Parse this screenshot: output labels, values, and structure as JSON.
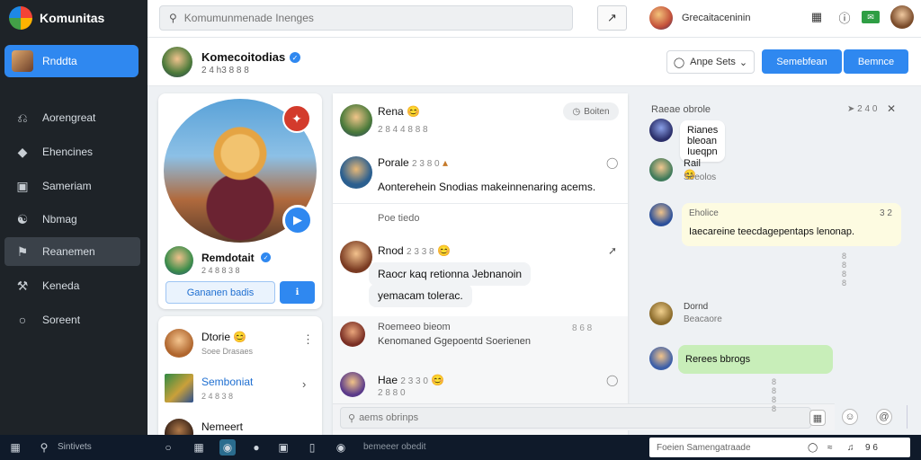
{
  "app": {
    "name": "Komunitas"
  },
  "sidebar": {
    "active": {
      "label": "Rnddta"
    },
    "items": [
      {
        "label": "Aorengreat",
        "icon": "headset-icon"
      },
      {
        "label": "Ehencines",
        "icon": "tag-icon"
      },
      {
        "label": "Sameriam",
        "icon": "film-icon"
      },
      {
        "label": "Nbmag",
        "icon": "globe-icon"
      },
      {
        "label": "Reanemen",
        "icon": "flag-icon"
      },
      {
        "label": "Keneda",
        "icon": "wrench-icon"
      },
      {
        "label": "Soreent",
        "icon": "circle-icon"
      }
    ]
  },
  "topbar": {
    "search_placeholder": "Komumunmenade Inenges",
    "user_label": "Grecaitaceninin"
  },
  "header": {
    "title": "Komecoitodias",
    "meta": "2 4 h3 8 8 8",
    "sort_label": "Anpe Sets",
    "primary_1": "Semebfean",
    "primary_2": "Bemnce"
  },
  "profile": {
    "name": "Remdotait",
    "meta": "2 4 8 8 3 8",
    "follow_label": "Gananen badis"
  },
  "friends": [
    {
      "name": "Dtorie",
      "emoji": "😊",
      "sub": "Soee Drasaes"
    },
    {
      "name": "Semboniat",
      "sub": "2 4 8 3 8"
    },
    {
      "name": "Nemeert"
    }
  ],
  "feed": {
    "chip": "Boiten",
    "posts": [
      {
        "name": "Rena",
        "emoji": "😊",
        "meta": "2 8 4 4 8 8 8"
      },
      {
        "name": "Porale",
        "meta": "2 3 8 0",
        "body": "Aonterehein Snodias makeinnenaring acems."
      },
      {
        "divider_label": "Poe tiedo"
      },
      {
        "name": "Rnod",
        "meta": "2 3 3 8",
        "body1": "Raocr kaq retionna Jebnanoin",
        "body2": "yemacam tolerac."
      },
      {
        "name": "Roemeeo bieom",
        "sub": "Kenomaned Ggepoentd Soerienen",
        "time": "8 6 8"
      },
      {
        "name": "Hae",
        "emoji": "😊",
        "meta": "2 3 3 0",
        "sub": "2 8 8 0"
      }
    ]
  },
  "compose": {
    "placeholder": "aems obrinps"
  },
  "chat": {
    "header": "Raeae obrole",
    "header_time": "2 4 0",
    "messages": [
      {
        "text": "Rianes bleoan Iueqpn"
      },
      {
        "name": "Rail",
        "emoji": "😊",
        "sub": "Seeolos"
      },
      {
        "top_left": "Eholice",
        "top_right": "3 2",
        "text": "Iaecareine teecdagepentaps lenonap.",
        "time": "8 8 8 8"
      },
      {
        "name": "Dornd",
        "sub": "Beacaore"
      },
      {
        "text": "Rerees bbrogs",
        "time": "8 8 8 8"
      }
    ]
  },
  "taskbar": {
    "search_label": "Sintivets",
    "center_label": "bemeeer obedit",
    "search_box": "Foeien Samengatraade",
    "time": "9 6"
  }
}
